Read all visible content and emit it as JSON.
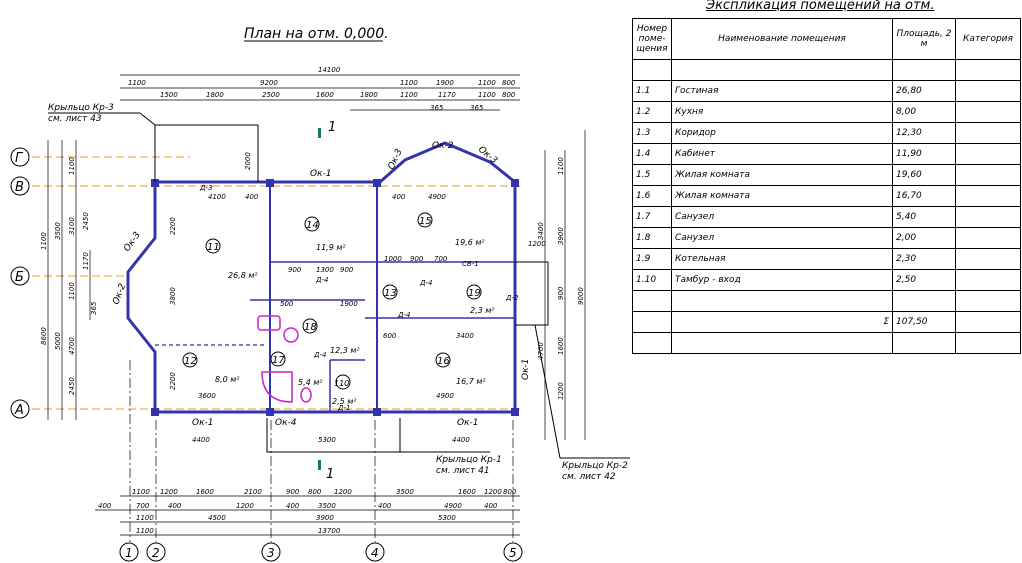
{
  "plan": {
    "title": "План на отм. 0,000.",
    "section_mark": "1",
    "axes_rows": [
      "Г",
      "В",
      "Б",
      "А"
    ],
    "axes_cols": [
      "1",
      "2",
      "3",
      "4",
      "5"
    ],
    "porch_labels": [
      {
        "line1": "Крыльцо Кр-3",
        "line2": "см. лист 43"
      },
      {
        "line1": "Крыльцо Кр-1",
        "line2": "см. лист 41"
      },
      {
        "line1": "Крыльцо Кр-2",
        "line2": "см. лист 42"
      }
    ],
    "windows": [
      "Ок-1",
      "Ок-2",
      "Ок-3",
      "Ок-2",
      "Ок-3",
      "Ок-2",
      "Ок-3",
      "Ок-1",
      "Ок-4",
      "Ок-1",
      "Ок-1"
    ],
    "doors": [
      "Д-3",
      "Д-4",
      "Д-4",
      "Д-4",
      "Д-4",
      "Д-1",
      "Д-2",
      "СВ-1"
    ],
    "rooms": [
      {
        "num": "11",
        "area": "26,8 м²"
      },
      {
        "num": "14",
        "area": "11,9 м²"
      },
      {
        "num": "15",
        "area": "19,6 м²"
      },
      {
        "num": "12",
        "area": "8,0 м²"
      },
      {
        "num": "13",
        "area": "12,3 м²"
      },
      {
        "num": "17",
        "area": "5,4 м²"
      },
      {
        "num": "18",
        "area": ""
      },
      {
        "num": "19",
        "area": "2,3 м²"
      },
      {
        "num": "16",
        "area": "16,7 м²"
      },
      {
        "num": "110",
        "area": "2,5 м²"
      }
    ],
    "dims_top_1": [
      "14100"
    ],
    "dims_top_2": [
      "1100",
      "9200",
      "1100",
      "1900",
      "1100",
      "800"
    ],
    "dims_top_3": [
      "1500",
      "1800",
      "2500",
      "1600",
      "1800",
      "1100",
      "1170",
      "1100",
      "800"
    ],
    "dims_top_4": [
      "365",
      "365"
    ],
    "dims_inner": [
      "4100",
      "400",
      "4900",
      "400",
      "2000",
      "2200",
      "3800",
      "2200",
      "3600",
      "100",
      "900",
      "1300",
      "900",
      "1300",
      "1000",
      "900",
      "700",
      "500",
      "1900",
      "1200",
      "600",
      "900",
      "3400",
      "4900",
      "3400",
      "1200",
      "1000",
      "3400",
      "1200",
      "4400",
      "5300",
      "4400",
      "1200",
      "990",
      "990",
      "990",
      "1100",
      "1100",
      "1300",
      "1900"
    ],
    "dims_left": [
      "400",
      "1100",
      "1200",
      "3500",
      "3100",
      "400",
      "2450",
      "1100",
      "1170",
      "8600",
      "400",
      "1100",
      "365",
      "5000",
      "4700",
      "1100",
      "2450",
      "400"
    ],
    "dims_right": [
      "1100",
      "1200",
      "3900",
      "3400",
      "400",
      "9000",
      "900",
      "1400",
      "1200",
      "4700",
      "1600",
      "1200",
      "400"
    ],
    "dims_bottom_1": [
      "1100",
      "1200",
      "1600",
      "2100",
      "900",
      "800",
      "1200",
      "3500",
      "1600",
      "1200",
      "800"
    ],
    "dims_bottom_2": [
      "400",
      "700",
      "400",
      "1200",
      "400",
      "3500",
      "400",
      "4900",
      "400"
    ],
    "dims_bottom_3": [
      "1100",
      "4500",
      "3900",
      "5300"
    ],
    "dims_bottom_4": [
      "1100",
      "13700"
    ]
  },
  "explication": {
    "title": "Экспликация помещений на отм.",
    "headers": {
      "num": "Номер поме- щения",
      "name": "Наименование помещения",
      "area": "Площадь, 2 м",
      "category": "Категория"
    },
    "rows": [
      {
        "num": "1.1",
        "name": "Гостиная",
        "area": "26,80"
      },
      {
        "num": "1.2",
        "name": "Кухня",
        "area": "8,00"
      },
      {
        "num": "1.3",
        "name": "Коридор",
        "area": "12,30"
      },
      {
        "num": "1.4",
        "name": "Кабинет",
        "area": "11,90"
      },
      {
        "num": "1.5",
        "name": "Жилая комната",
        "area": "19,60"
      },
      {
        "num": "1.6",
        "name": "Жилая комната",
        "area": "16,70"
      },
      {
        "num": "1.7",
        "name": "Санузел",
        "area": "5,40"
      },
      {
        "num": "1.8",
        "name": "Санузел",
        "area": "2,00"
      },
      {
        "num": "1.9",
        "name": "Котельная",
        "area": "2,30"
      },
      {
        "num": "1.10",
        "name": "Тамбур - вход",
        "area": "2,50"
      }
    ],
    "total_symbol": "Σ",
    "total": "107,50"
  },
  "colors": {
    "wall": "#3333aa",
    "axis": "#e8a020",
    "sanitary": "#cc22cc",
    "line": "#000000"
  }
}
